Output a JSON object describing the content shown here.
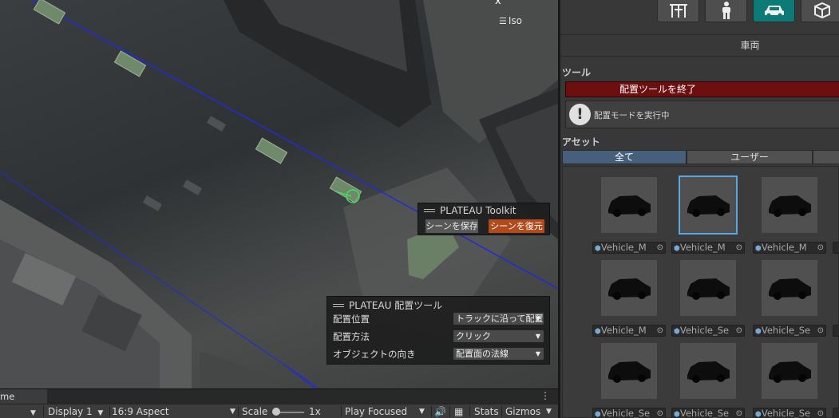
{
  "scene": {
    "iso_label": "Iso",
    "close_glyph": "x",
    "toolkit": {
      "title": "PLATEAU Toolkit",
      "save_label": "シーンを保存",
      "restore_label": "シーンを復元"
    },
    "placement": {
      "title": "PLATEAU 配置ツール",
      "rows": [
        {
          "label": "配置位置",
          "value": "トラックに沿って配置"
        },
        {
          "label": "配置方法",
          "value": "クリック"
        },
        {
          "label": "オブジェクトの向き",
          "value": "配置面の法線"
        }
      ]
    }
  },
  "game_tab": {
    "name": "me",
    "more_glyph": "⋮"
  },
  "toolbar": {
    "display": "Display 1",
    "aspect": "16:9 Aspect",
    "scale_label": "Scale",
    "scale_value": "1x",
    "play_mode": "Play Focused",
    "stats": "Stats",
    "gizmos": "Gizmos"
  },
  "panel": {
    "category_icons": [
      "pole-icon",
      "person-icon",
      "car-icon",
      "cube-icon"
    ],
    "active_category": "car-icon",
    "header": "車両",
    "tools_label": "ツール",
    "end_button": "配置ツールを終了",
    "help_text": "配置モードを実行中",
    "assets_label": "アセット",
    "filter_tabs": [
      "全て",
      "ユーザー"
    ],
    "active_filter": "全て",
    "assets": [
      {
        "name": "Vehicle_M",
        "selected": false
      },
      {
        "name": "Vehicle_M",
        "selected": true
      },
      {
        "name": "Vehicle_M",
        "selected": false
      },
      {
        "name": "Vehicle_M",
        "selected": false
      },
      {
        "name": "Vehicle_Se",
        "selected": false
      },
      {
        "name": "Vehicle_Se",
        "selected": false
      },
      {
        "name": "Vehicle_Se",
        "selected": false
      },
      {
        "name": "Vehicle_Se",
        "selected": false
      },
      {
        "name": "Vehicle_Se",
        "selected": false
      }
    ],
    "colors": {
      "accent_active": "#0c7b78",
      "end_button": "#6d0f0f",
      "tab_active": "#46607c",
      "selection": "#58a8e6"
    }
  }
}
